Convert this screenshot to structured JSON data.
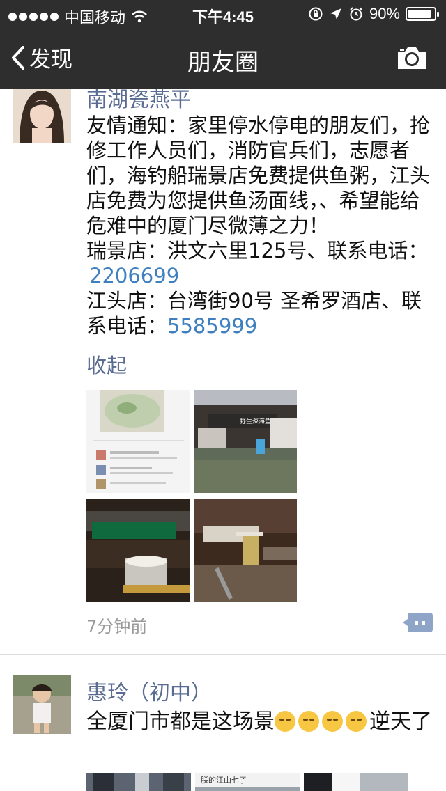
{
  "status_bar": {
    "carrier": "中国移动",
    "time": "下午4:45",
    "battery": "90%",
    "battery_level": 0.9
  },
  "nav": {
    "back_label": "发现",
    "title": "朋友圈"
  },
  "post1": {
    "author": "南湖瓷燕平",
    "text": "友情通知：家里停水停电的朋友们，抢修工作人员们，消防官兵们，志愿者们，海钓船瑞景店免费提供鱼粥，江头店免费为您提供鱼汤面线，、希望能给危难中的厦门尽微薄之力！",
    "line1_prefix": "瑞景店：洪文六里125号、联系电话",
    "line1_colon": "：",
    "phone1": "2206699",
    "line2_prefix": "江头店：台湾街90号 圣希罗酒店、联系电话：",
    "phone2": "5585999",
    "collapse_label": "收起",
    "time": "7分钟前",
    "image_sign_text": "野生深海鱼外卖"
  },
  "post2": {
    "author": "惠玲（初中）",
    "text_before": "全厦门市都是这场景",
    "text_after": "逆天了",
    "emoji_count": 4,
    "strip_text": "朕的江山七了"
  },
  "colors": {
    "bar_bg": "#2e2e2e",
    "name_color": "#5a6c93",
    "link_color": "#3d7fbf"
  }
}
